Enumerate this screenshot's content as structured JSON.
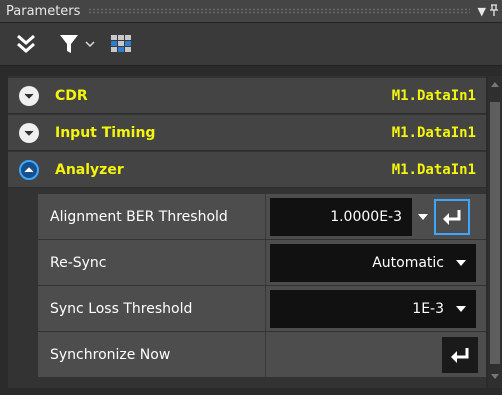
{
  "window": {
    "title": "Parameters"
  },
  "toolbar": {
    "collapse_icon": "double-chevron-down-icon",
    "filter_icon": "filter-icon",
    "layout_icon": "grid-layout-icon"
  },
  "sections": [
    {
      "name": "CDR",
      "source": "M1.DataIn1",
      "expanded": false
    },
    {
      "name": "Input Timing",
      "source": "M1.DataIn1",
      "expanded": false
    },
    {
      "name": "Analyzer",
      "source": "M1.DataIn1",
      "expanded": true
    }
  ],
  "analyzer": {
    "alignment_ber": {
      "label": "Alignment BER Threshold",
      "value": "1.0000E-3"
    },
    "resync": {
      "label": "Re-Sync",
      "value": "Automatic"
    },
    "sync_loss": {
      "label": "Sync Loss Threshold",
      "value": "1E-3"
    },
    "sync_now": {
      "label": "Synchronize Now"
    }
  },
  "colors": {
    "section_text": "#f4f40d",
    "accent": "#3da7ff"
  }
}
